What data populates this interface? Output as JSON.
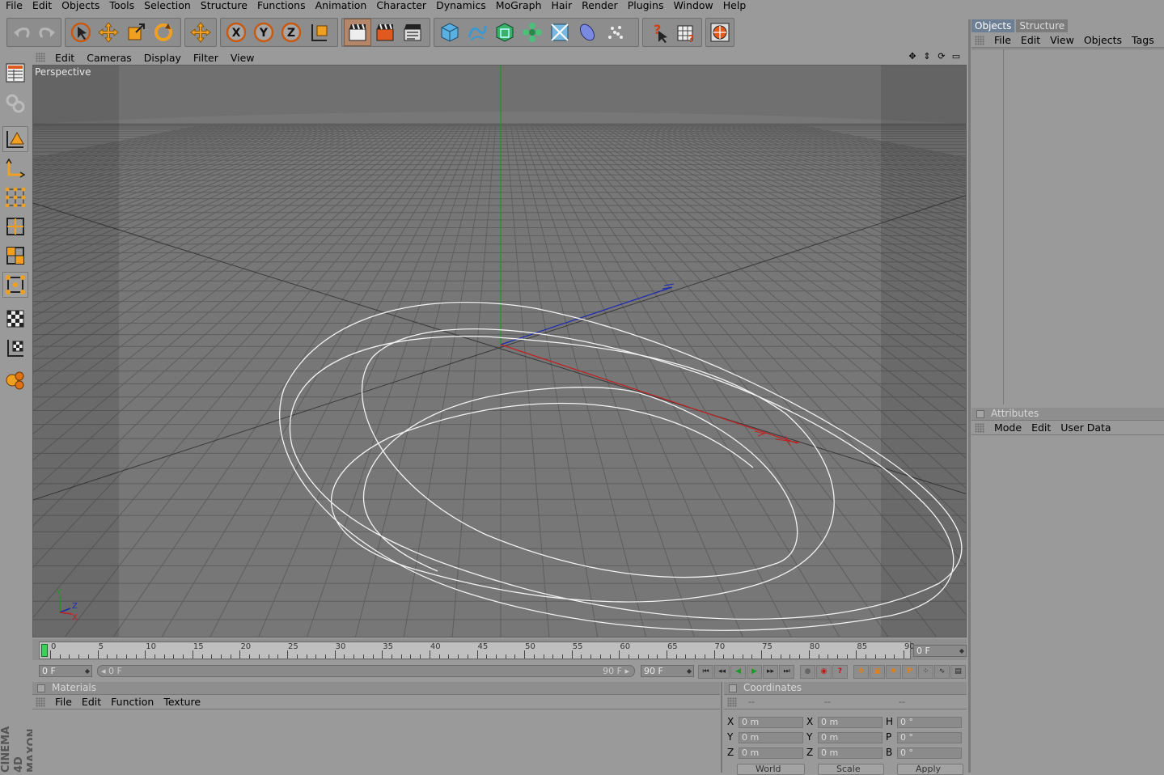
{
  "menu": [
    "File",
    "Edit",
    "Objects",
    "Tools",
    "Selection",
    "Structure",
    "Functions",
    "Animation",
    "Character",
    "Dynamics",
    "MoGraph",
    "Hair",
    "Render",
    "Plugins",
    "Window",
    "Help"
  ],
  "toolbar_axis": {
    "x": "X",
    "y": "Y",
    "z": "Z"
  },
  "viewport": {
    "menu": [
      "Edit",
      "Cameras",
      "Display",
      "Filter",
      "View"
    ],
    "label": "Perspective",
    "icons": [
      "move-view-icon",
      "dolly-view-icon",
      "rotate-view-icon",
      "maximize-view-icon"
    ],
    "axis_gizmo": {
      "y": "Y",
      "z": "Z",
      "x": "X"
    }
  },
  "timeline": {
    "ticks": [
      "0",
      "5",
      "10",
      "15",
      "20",
      "25",
      "30",
      "35",
      "40",
      "45",
      "50",
      "55",
      "60",
      "65",
      "70",
      "75",
      "80",
      "85",
      "90"
    ],
    "current_frame_field": "0 F",
    "start_field": "0 F",
    "range_start": "0 F",
    "range_end": "90 F",
    "end_field": "90 F"
  },
  "objects_panel": {
    "tab_active": "Objects",
    "tab_inactive": "Structure",
    "menu": [
      "File",
      "Edit",
      "View",
      "Objects",
      "Tags"
    ]
  },
  "attributes_panel": {
    "title": "Attributes",
    "menu": [
      "Mode",
      "Edit",
      "User Data"
    ]
  },
  "materials_panel": {
    "title": "Materials",
    "menu": [
      "File",
      "Edit",
      "Function",
      "Texture"
    ]
  },
  "coordinates_panel": {
    "title": "Coordinates",
    "col_headers": [
      "--",
      "--",
      "--"
    ],
    "rows": [
      {
        "a": "X",
        "av": "0 m",
        "b": "X",
        "bv": "0 m",
        "c": "H",
        "cv": "0 °"
      },
      {
        "a": "Y",
        "av": "0 m",
        "b": "Y",
        "bv": "0 m",
        "c": "P",
        "cv": "0 °"
      },
      {
        "a": "Z",
        "av": "0 m",
        "b": "Z",
        "bv": "0 m",
        "c": "B",
        "cv": "0 °"
      }
    ],
    "mode_select": "World",
    "scale_select": "Scale",
    "apply_label": "Apply"
  },
  "brand": "CINEMA 4D\nMAXON",
  "colors": {
    "accent_orange": "#e8901c",
    "selection_blue": "#6d7f94",
    "axis_x": "#c02020",
    "axis_y": "#1a9a1a",
    "axis_z": "#1a2ab0"
  }
}
